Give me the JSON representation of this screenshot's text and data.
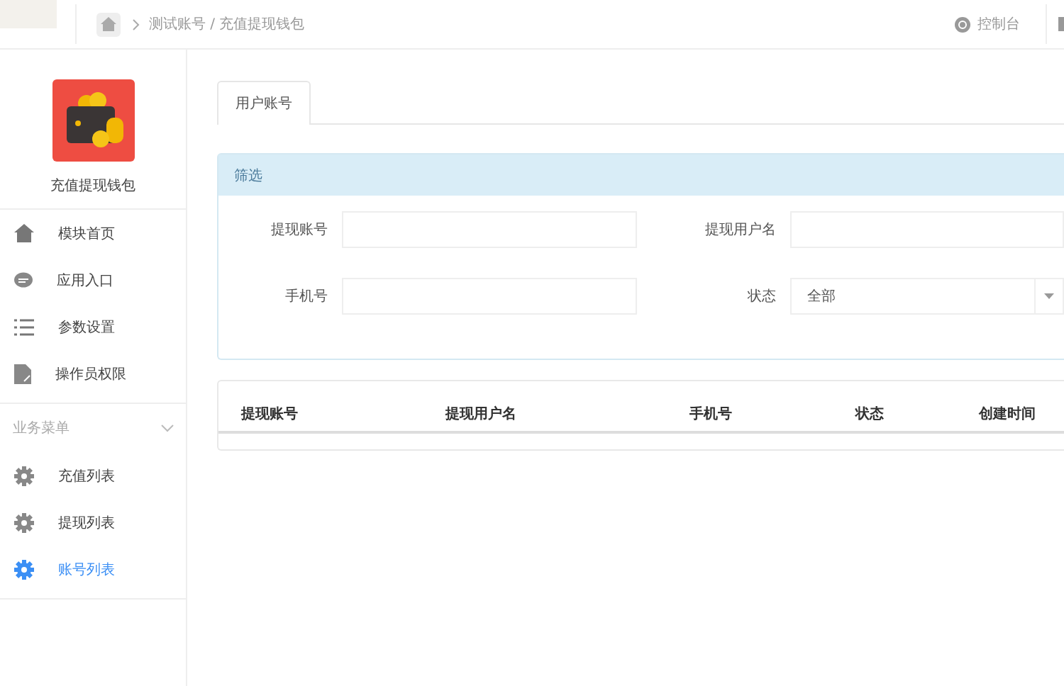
{
  "breadcrumb": {
    "trail": "测试账号 / 充值提现钱包"
  },
  "topbar": {
    "console_label": "控制台"
  },
  "sidebar": {
    "app_name": "充值提现钱包",
    "items": [
      {
        "label": "模块首页",
        "kind": "home",
        "selected": false
      },
      {
        "label": "应用入口",
        "kind": "chat",
        "selected": false
      },
      {
        "label": "参数设置",
        "kind": "list",
        "selected": false
      },
      {
        "label": "操作员权限",
        "kind": "doc",
        "selected": false
      }
    ],
    "group": {
      "title": "业务菜单",
      "expanded": true,
      "items": [
        {
          "label": "充值列表",
          "selected": false
        },
        {
          "label": "提现列表",
          "selected": false
        },
        {
          "label": "账号列表",
          "selected": true
        }
      ]
    }
  },
  "tabs": [
    {
      "label": "用户账号",
      "selected": true
    }
  ],
  "filter": {
    "title": "筛选",
    "fields": [
      {
        "label": "提现账号",
        "kind": "input"
      },
      {
        "label": "提现用户名",
        "kind": "input"
      },
      {
        "label": "手机号",
        "kind": "input"
      },
      {
        "label": "状态",
        "kind": "select",
        "value": "全部"
      }
    ]
  },
  "table": {
    "columns": [
      "提现账号",
      "提现用户名",
      "手机号",
      "状态",
      "创建时间"
    ]
  }
}
